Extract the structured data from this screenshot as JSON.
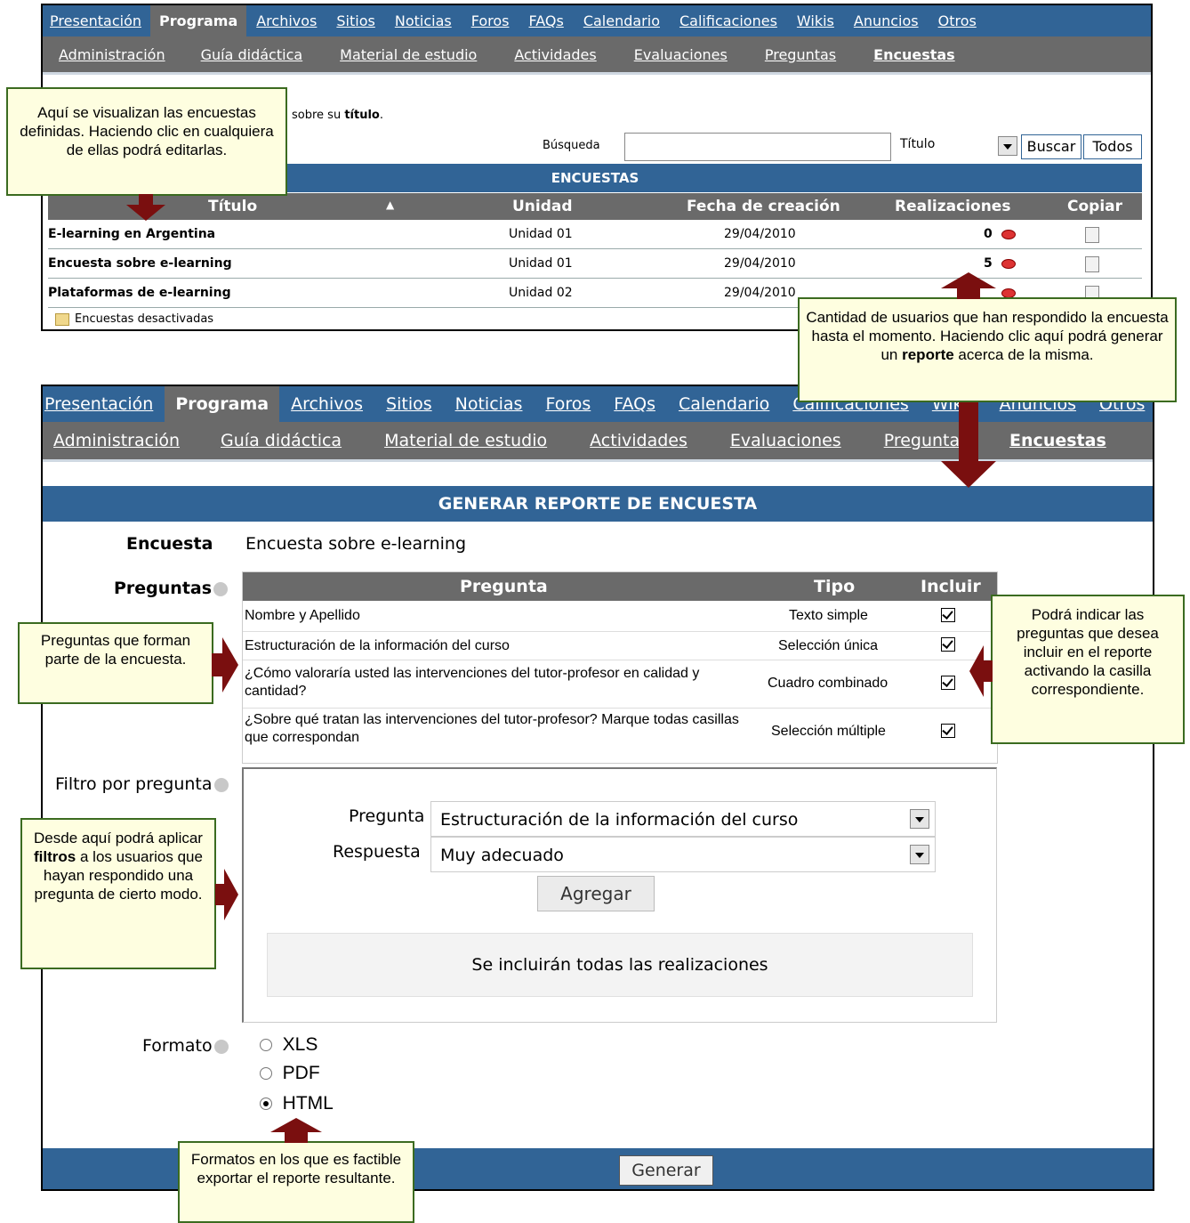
{
  "top": {
    "nav_main": [
      "Presentación",
      "Programa",
      "Archivos",
      "Sitios",
      "Noticias",
      "Foros",
      "FAQs",
      "Calendario",
      "Calificaciones",
      "Wikis",
      "Anuncios",
      "Otros"
    ],
    "nav_sub": [
      "Administración",
      "Guía didáctica",
      "Material de estudio",
      "Actividades",
      "Evaluaciones",
      "Preguntas",
      "Encuestas"
    ],
    "intro_text": "sobre su",
    "intro_bold": "título",
    "search_label": "Búsqueda",
    "search_value": "",
    "search_field": "Título",
    "search_button": "Buscar",
    "all_button": "Todos",
    "table_title": "ENCUESTAS",
    "columns": [
      "Título",
      "Unidad",
      "Fecha de creación",
      "Realizaciones",
      "Copiar"
    ],
    "rows": [
      {
        "titulo": "E-learning en Argentina",
        "unidad": "Unidad 01",
        "fecha": "29/04/2010",
        "realizaciones": "0"
      },
      {
        "titulo": "Encuesta sobre e-learning",
        "unidad": "Unidad 01",
        "fecha": "29/04/2010",
        "realizaciones": "5"
      },
      {
        "titulo": "Plataformas de e-learning",
        "unidad": "Unidad 02",
        "fecha": "29/04/2010",
        "realizaciones": ""
      }
    ],
    "legend": "Encuestas desactivadas"
  },
  "bottom": {
    "nav_main": [
      "Presentación",
      "Programa",
      "Archivos",
      "Sitios",
      "Noticias",
      "Foros",
      "FAQs",
      "Calendario",
      "Calificaciones",
      "Wikis",
      "Anuncios",
      "Otros"
    ],
    "nav_sub": [
      "Administración",
      "Guía didáctica",
      "Material de estudio",
      "Actividades",
      "Evaluaciones",
      "Preguntas",
      "Encuestas"
    ],
    "title": "GENERAR REPORTE DE ENCUESTA",
    "encuesta_label": "Encuesta",
    "encuesta_value": "Encuesta sobre e-learning",
    "preguntas_label": "Preguntas",
    "q_columns": [
      "Pregunta",
      "Tipo",
      "Incluir"
    ],
    "questions": [
      {
        "pregunta": "Nombre y Apellido",
        "tipo": "Texto simple"
      },
      {
        "pregunta": "Estructuración de la información del curso",
        "tipo": "Selección única"
      },
      {
        "pregunta": "¿Cómo valoraría usted las intervenciones del tutor-profesor en calidad y cantidad?",
        "tipo": "Cuadro combinado"
      },
      {
        "pregunta": "¿Sobre qué tratan las intervenciones del tutor-profesor? Marque todas casillas que correspondan",
        "tipo": "Selección múltiple"
      }
    ],
    "filtro_label": "Filtro por pregunta",
    "filtro_pregunta_label": "Pregunta",
    "filtro_pregunta_value": "Estructuración de la información del curso",
    "filtro_respuesta_label": "Respuesta",
    "filtro_respuesta_value": "Muy adecuado",
    "agregar_button": "Agregar",
    "filtro_info": "Se incluirán todas las realizaciones",
    "formato_label": "Formato",
    "formatos": [
      "XLS",
      "PDF",
      "HTML"
    ],
    "formato_selected": "HTML",
    "generar_button": "Generar"
  },
  "callouts": {
    "c1": "Aquí se visualizan las encuestas definidas. Haciendo clic en cualquiera de ellas podrá editarlas.",
    "c2_a": "Cantidad de usuarios que han respondido la encuesta hasta el momento. Haciendo clic aquí podrá generar un",
    "c2_b": "reporte",
    "c2_c": "acerca de la misma.",
    "c3": "Preguntas que forman parte de la encuesta.",
    "c4": "Podrá indicar las preguntas que desea incluir en el reporte activando la casilla correspondiente.",
    "c5_a": "Desde aquí podrá aplicar",
    "c5_b": "filtros",
    "c5_c": "a los usuarios que hayan respondido una pregunta de cierto modo.",
    "c6": "Formatos en los que es factible exportar el reporte resultante."
  },
  "colors": {
    "header_blue": "#316496",
    "nav_gray": "#6a6a6a",
    "arrow": "#7a0f0f",
    "callout_bg": "#fefee0"
  }
}
